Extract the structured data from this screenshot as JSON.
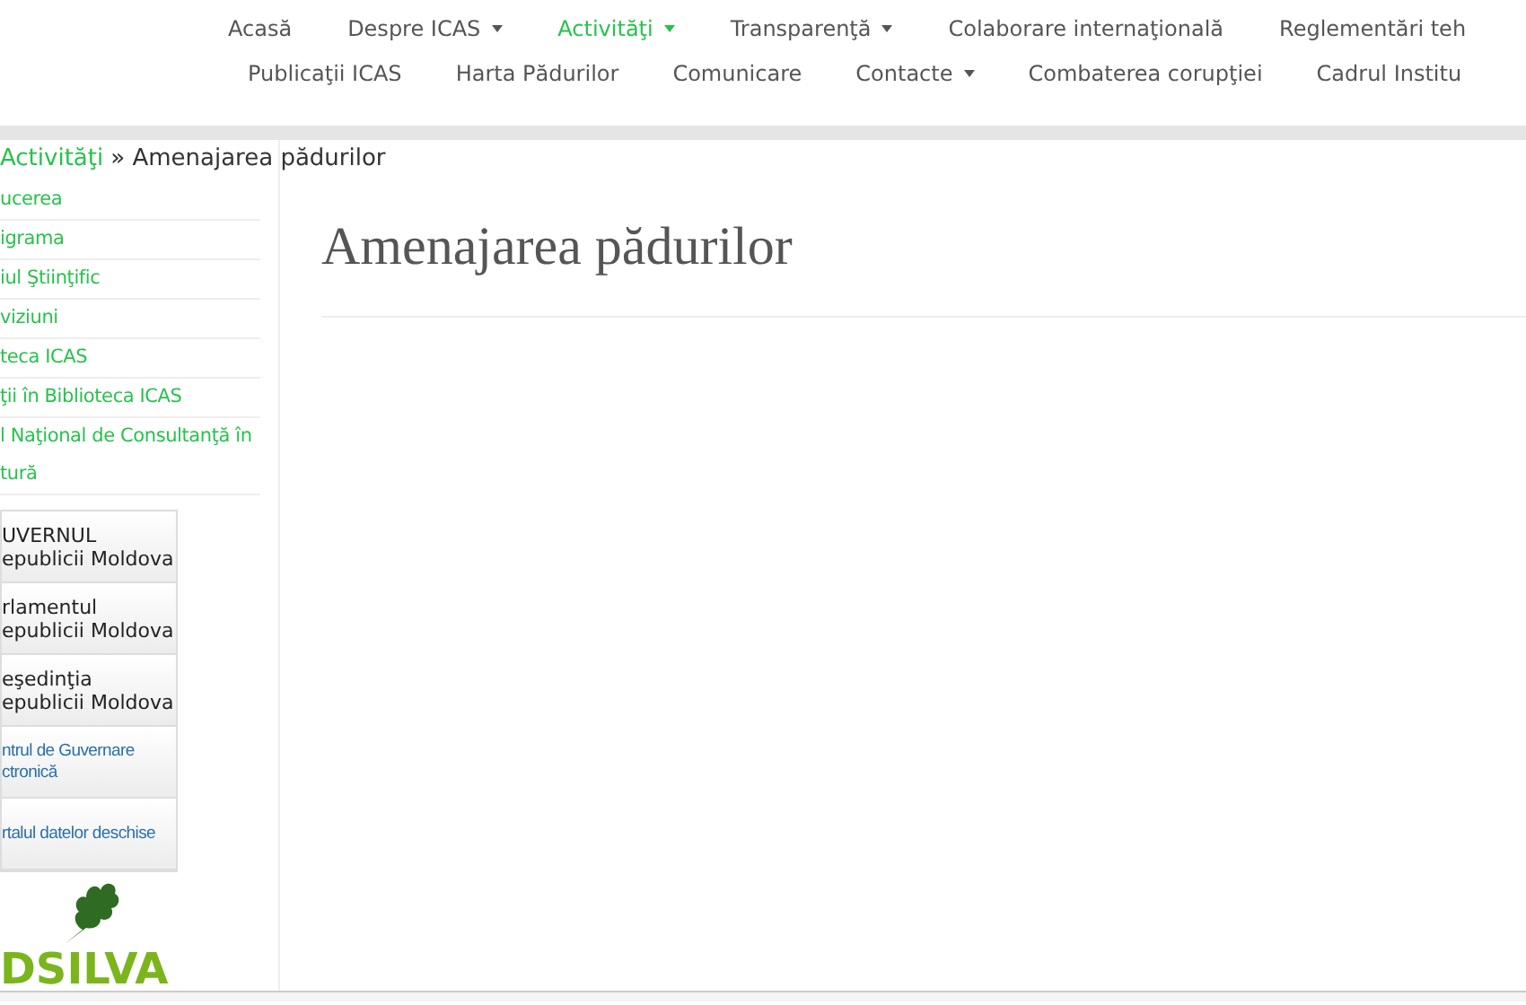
{
  "nav_rows": [
    [
      {
        "label": "Acasă",
        "dropdown": false,
        "selected": false
      },
      {
        "label": "Despre ICAS",
        "dropdown": true,
        "selected": false
      },
      {
        "label": "Activităţi",
        "dropdown": true,
        "selected": true
      },
      {
        "label": "Transparenţă",
        "dropdown": true,
        "selected": false
      },
      {
        "label": "Colaborare internaţională",
        "dropdown": false,
        "selected": false
      },
      {
        "label": "Reglementări teh",
        "dropdown": false,
        "selected": false
      }
    ],
    [
      {
        "label": "Publicaţii ICAS",
        "dropdown": false,
        "selected": false
      },
      {
        "label": "Harta Pădurilor",
        "dropdown": false,
        "selected": false
      },
      {
        "label": "Comunicare",
        "dropdown": false,
        "selected": false
      },
      {
        "label": "Contacte",
        "dropdown": true,
        "selected": false
      },
      {
        "label": "Combaterea corupţiei",
        "dropdown": false,
        "selected": false
      },
      {
        "label": "Cadrul Institu",
        "dropdown": false,
        "selected": false
      }
    ]
  ],
  "breadcrumb": {
    "link": "Activităţi",
    "current": "» Amenajarea pădurilor"
  },
  "sidebar": {
    "items": [
      "ucerea",
      "igrama",
      "iul Ştiinţific",
      "viziuni",
      "teca ICAS",
      "ţii în Biblioteca ICAS",
      "l Naţional de Consultanţă în tură"
    ],
    "banners": [
      {
        "kind": "plain",
        "lines": [
          "UVERNUL",
          "epublicii Moldova"
        ]
      },
      {
        "kind": "plain",
        "lines": [
          "rlamentul",
          "epublicii Moldova"
        ]
      },
      {
        "kind": "plain",
        "lines": [
          "eşedinţia",
          "epublicii Moldova"
        ]
      },
      {
        "kind": "blue",
        "lines": [
          "ntrul de Guvernare",
          "ctronică"
        ]
      },
      {
        "kind": "blue",
        "lines": [
          "rtalul datelor deschise"
        ]
      }
    ],
    "logo": "DSILVA"
  },
  "page_title": "Amenajarea pădurilor"
}
